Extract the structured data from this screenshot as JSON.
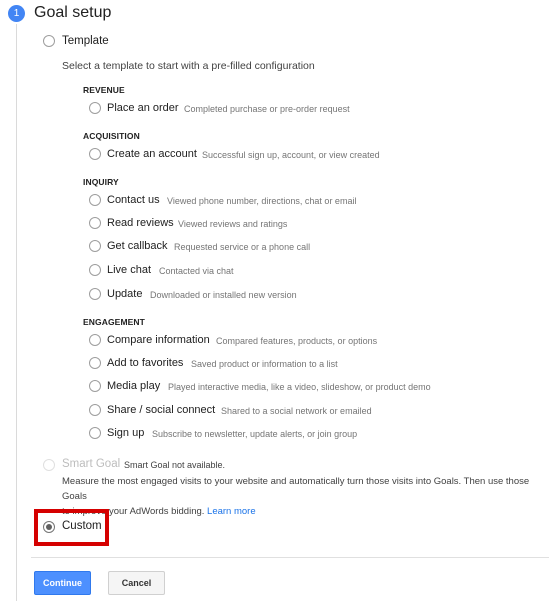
{
  "step": {
    "number": "1",
    "title": "Goal setup"
  },
  "template": {
    "label": "Template",
    "instruction": "Select a template to start with a pre-filled configuration"
  },
  "sections": {
    "revenue": "REVENUE",
    "acquisition": "ACQUISITION",
    "inquiry": "INQUIRY",
    "engagement": "ENGAGEMENT"
  },
  "options": {
    "place_order": {
      "label": "Place an order",
      "desc": "Completed purchase or pre-order request"
    },
    "create_account": {
      "label": "Create an account",
      "desc": "Successful sign up, account, or view created"
    },
    "contact_us": {
      "label": "Contact us",
      "desc": "Viewed phone number, directions, chat or email"
    },
    "read_reviews": {
      "label": "Read reviews",
      "desc": "Viewed reviews and ratings"
    },
    "get_callback": {
      "label": "Get callback",
      "desc": "Requested service or a phone call"
    },
    "live_chat": {
      "label": "Live chat",
      "desc": "Contacted via chat"
    },
    "update": {
      "label": "Update",
      "desc": "Downloaded or installed new version"
    },
    "compare_info": {
      "label": "Compare information",
      "desc": "Compared features, products, or options"
    },
    "add_favorites": {
      "label": "Add to favorites",
      "desc": "Saved product or information to a list"
    },
    "media_play": {
      "label": "Media play",
      "desc": "Played interactive media, like a video, slideshow, or product demo"
    },
    "share_social": {
      "label": "Share / social connect",
      "desc": "Shared to a social network or emailed"
    },
    "sign_up": {
      "label": "Sign up",
      "desc": "Subscribe to newsletter, update alerts, or join group"
    }
  },
  "smart_goal": {
    "label": "Smart Goal",
    "status": "Smart Goal not available.",
    "description_line1": "Measure the most engaged visits to your website and automatically turn those visits into Goals. Then use those Goals",
    "description_line2": "to improve your AdWords bidding.",
    "learn_more": "Learn more"
  },
  "custom": {
    "label": "Custom",
    "selected": true
  },
  "buttons": {
    "continue": "Continue",
    "cancel": "Cancel"
  },
  "colors": {
    "accent": "#4285f4",
    "highlight": "#d50000",
    "primary_button": "#4d90fe"
  }
}
